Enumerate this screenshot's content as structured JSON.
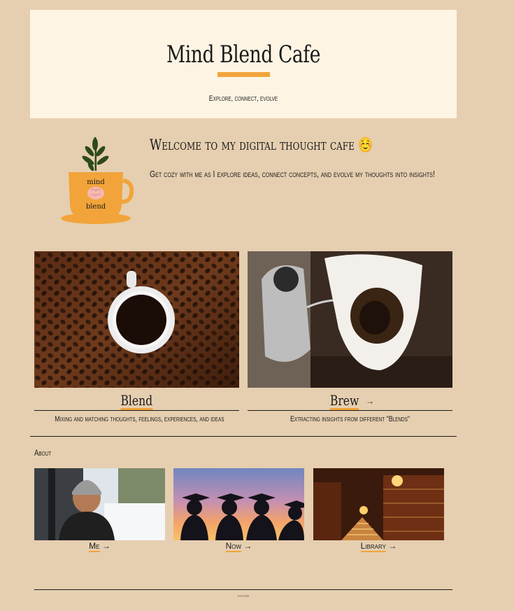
{
  "header": {
    "title": "Mind Blend Cafe",
    "tagline": "Explore, connect, evolve"
  },
  "logo": {
    "top_word": "mind",
    "bottom_word": "blend",
    "icon": "brain-cup-plant-logo"
  },
  "welcome": {
    "title": "Welcome to my digital thought cafe ☺️",
    "text": "Get cozy with me as I explore ideas, connect concepts, and evolve my thoughts into insights!"
  },
  "cards": [
    {
      "title": "Blend",
      "arrow": "",
      "description": "Mixing and matching thoughts, feelings, experiences, and ideas",
      "image": "coffee-beans-cup-photo"
    },
    {
      "title": "Brew",
      "arrow": "→",
      "description": "Extracting insights from different \"Blends\"",
      "image": "pour-over-coffee-photo"
    }
  ],
  "about": {
    "heading": "About",
    "tiles": [
      {
        "label": "Me",
        "arrow": "→",
        "image": "portrait-snow-photo"
      },
      {
        "label": "Now",
        "arrow": "→",
        "image": "graduation-silhouette-photo"
      },
      {
        "label": "Library",
        "arrow": "→",
        "image": "library-interior-photo"
      }
    ]
  },
  "footer": {
    "text": "footer"
  },
  "colors": {
    "background": "#e6cfb0",
    "hero": "#fdf4e3",
    "accent": "#f2a43a"
  }
}
